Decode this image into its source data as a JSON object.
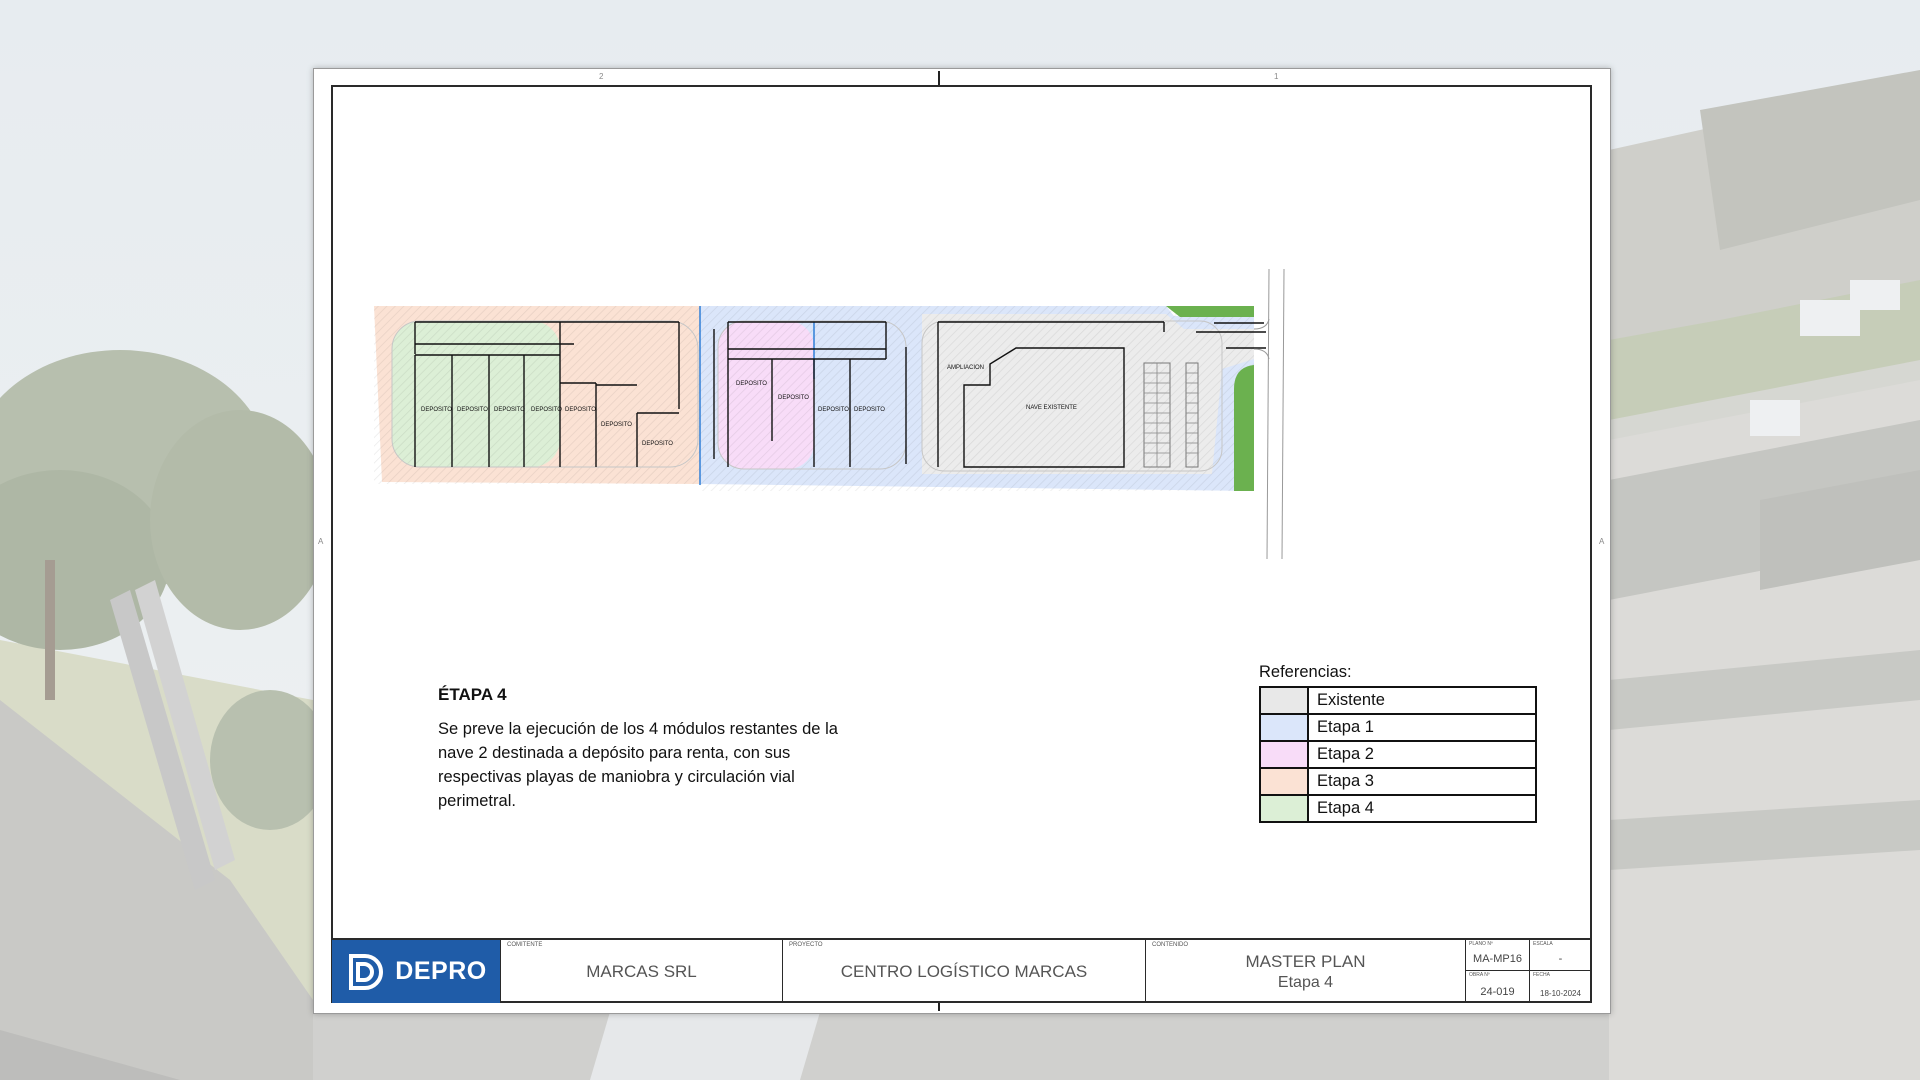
{
  "stage": {
    "title": "ÉTAPA 4",
    "description": "Se preve la ejecución de los 4 módulos restantes de la nave 2 destinada a depósito para renta, con sus respectivas playas de maniobra y circulación vial perimetral."
  },
  "legend": {
    "title": "Referencias:",
    "items": [
      {
        "label": "Existente",
        "color": "#e8e8e8"
      },
      {
        "label": "Etapa 1",
        "color": "#dbe6fa"
      },
      {
        "label": "Etapa 2",
        "color": "#f8dcf8"
      },
      {
        "label": "Etapa 3",
        "color": "#fbe2d4"
      },
      {
        "label": "Etapa 4",
        "color": "#dcefd6"
      }
    ]
  },
  "plan_labels": {
    "deposito": "DEPOSITO",
    "ampliacion": "AMPLIACION",
    "nave_existente": "NAVE EXISTENTE"
  },
  "sheet_marks": {
    "top_left": "2",
    "top_right": "1",
    "side": "A"
  },
  "title_block": {
    "logo_text": "DEPRO",
    "comitente_caption": "COMITENTE",
    "comitente": "MARCAS SRL",
    "proyecto_caption": "PROYECTO",
    "proyecto": "CENTRO LOGÍSTICO MARCAS",
    "contenido_caption": "CONTENIDO",
    "contenido_line1": "MASTER PLAN",
    "contenido_line2": "Etapa 4",
    "plano_caption": "PLANO Nº",
    "plano": "MA-MP16",
    "escala_caption": "ESCALA",
    "escala": "-",
    "obra_caption": "OBRA Nº",
    "obra": "24-019",
    "fecha_caption": "FECHA",
    "fecha": "18-10-2024"
  },
  "colors": {
    "brand_blue": "#1f5ca8",
    "stage_line_blue": "#2f7fd8",
    "green_verge": "#6bb14f"
  }
}
